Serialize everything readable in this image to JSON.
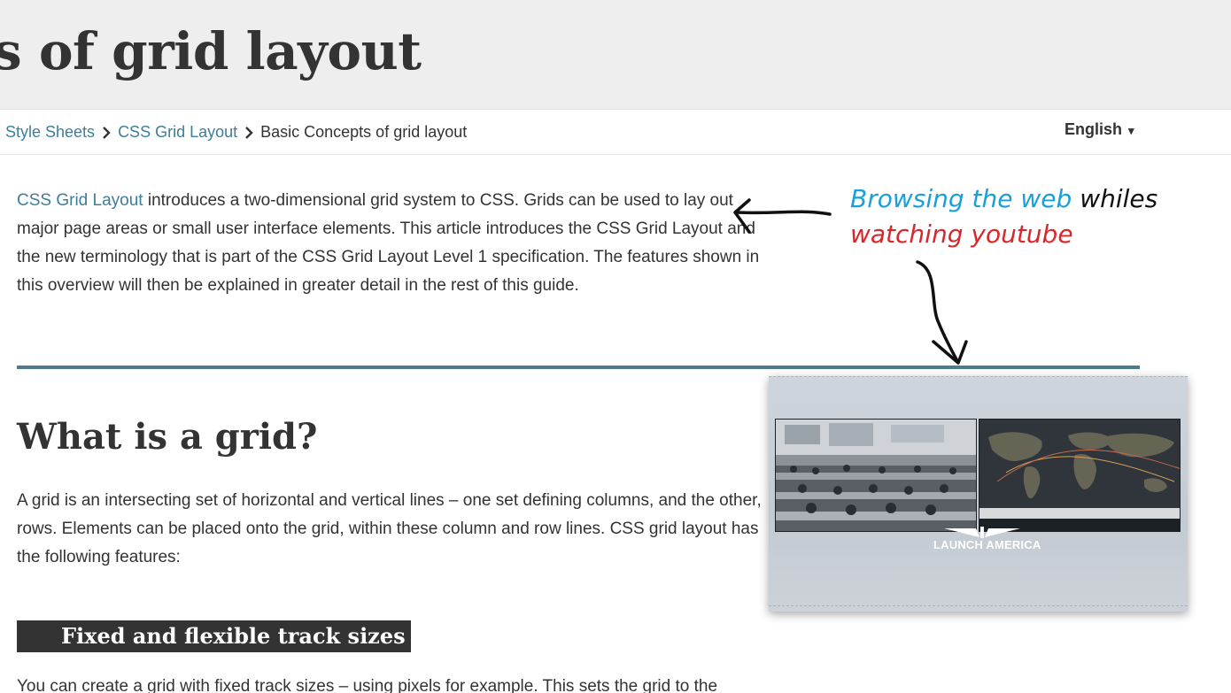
{
  "header": {
    "title": "s of grid layout"
  },
  "breadcrumb": {
    "items": [
      "Style Sheets",
      "CSS Grid Layout"
    ],
    "current": "Basic Concepts of grid layout"
  },
  "language": {
    "label": "English",
    "caret": "▾"
  },
  "intro": {
    "link": "CSS Grid Layout",
    "text": " introduces a two-dimensional grid system to CSS. Grids can be used to lay out major page areas or small user interface elements. This article introduces the CSS Grid Layout and the new terminology that is part of the CSS Grid Layout Level 1 specification. The features shown in this overview will then be explained in greater detail in the rest of this guide."
  },
  "section": {
    "heading": "What is a grid?",
    "paragraph": "A grid is an intersecting set of horizontal and vertical lines – one set defining columns, and the other, rows. Elements can be placed onto the grid, within these column and row lines. CSS grid layout has the following features:",
    "subheading": "Fixed and flexible track sizes",
    "paragraph2": "You can create a grid with fixed track sizes – using pixels for example. This sets the grid to the"
  },
  "annotation": {
    "part1": "Browsing the web",
    "part2": " whiles",
    "part3": "watching youtube"
  },
  "pip_video": {
    "logo_text": "LAUNCH AMERICA"
  },
  "colors": {
    "link": "#3d7e9a",
    "rule": "#4d7a93",
    "annotation_blue": "#1aa0d8",
    "annotation_red": "#d9262b"
  }
}
